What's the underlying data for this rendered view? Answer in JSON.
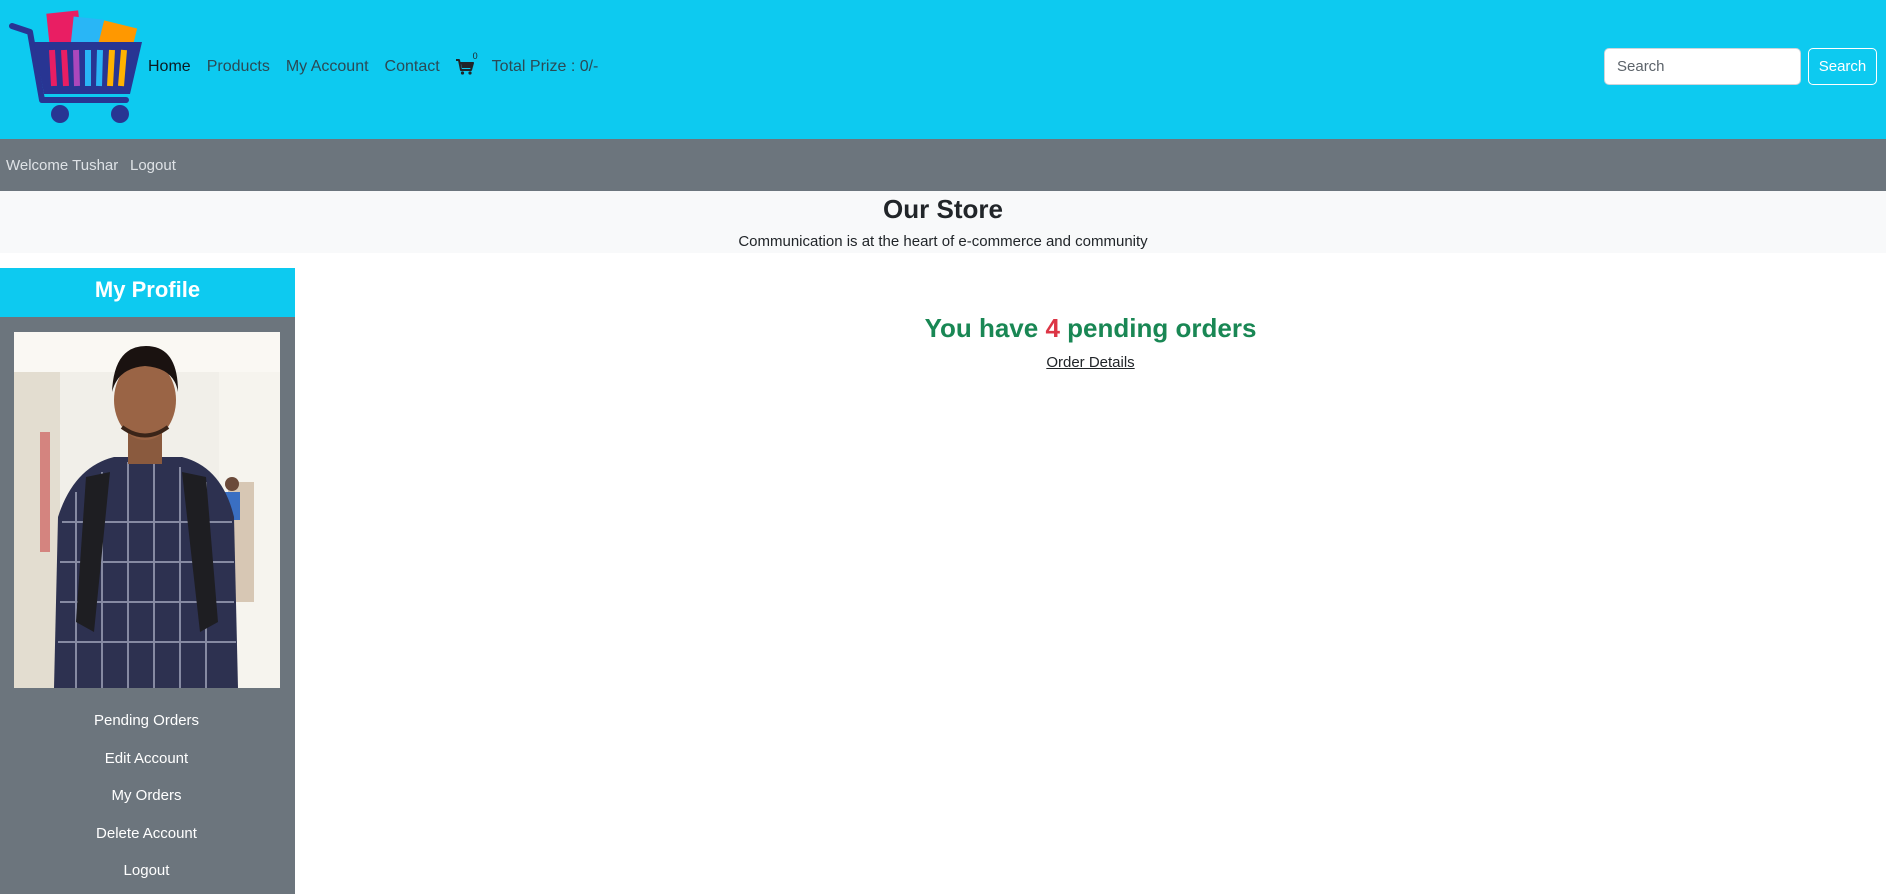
{
  "nav": {
    "links": [
      "Home",
      "Products",
      "My Account",
      "Contact"
    ],
    "cart_icon": "shopping-cart-icon",
    "cart_count": "0",
    "total_prize": "Total Prize : 0/-",
    "search_placeholder": "Search",
    "search_button": "Search"
  },
  "subbar": {
    "welcome": "Welcome Tushar",
    "logout": "Logout"
  },
  "store": {
    "title": "Our Store",
    "subtitle": "Communication is at the heart of e-commerce and community"
  },
  "sidebar": {
    "title": "My Profile",
    "menu": [
      "Pending Orders",
      "Edit Account",
      "My Orders",
      "Delete Account",
      "Logout"
    ]
  },
  "main": {
    "pending_prefix": "You have",
    "pending_count": "4",
    "pending_suffix": "pending orders",
    "order_details": "Order Details"
  },
  "colors": {
    "navbar": "#0dcaf0",
    "subbar": "#6c757d",
    "success": "#198754",
    "danger": "#dc3545"
  }
}
